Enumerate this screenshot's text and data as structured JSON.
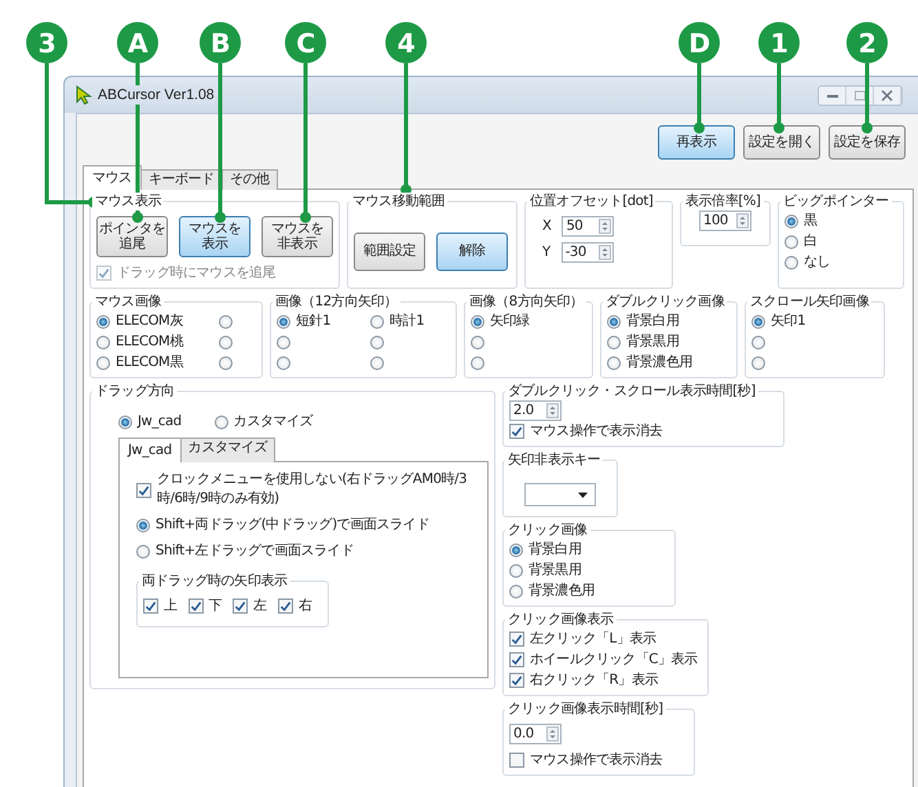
{
  "callouts": [
    {
      "label": "3"
    },
    {
      "label": "A"
    },
    {
      "label": "B"
    },
    {
      "label": "C"
    },
    {
      "label": "4"
    },
    {
      "label": "D"
    },
    {
      "label": "1"
    },
    {
      "label": "2"
    }
  ],
  "window": {
    "title": "ABCursor Ver1.08"
  },
  "toolbar": [
    {
      "label": "再表示",
      "highlighted": true
    },
    {
      "label": "設定を開く",
      "highlighted": false
    },
    {
      "label": "設定を保存",
      "highlighted": false
    }
  ],
  "tabs": [
    {
      "label": "マウス",
      "selected": true
    },
    {
      "label": "キーボード",
      "selected": false
    },
    {
      "label": "その他",
      "selected": false
    }
  ],
  "mouse_display": {
    "title": "マウス表示",
    "buttons": [
      {
        "lines": [
          "ポインタを",
          "追尾"
        ],
        "highlighted": false
      },
      {
        "lines": [
          "マウスを",
          "表示"
        ],
        "highlighted": true
      },
      {
        "lines": [
          "マウスを",
          "非表示"
        ],
        "highlighted": false
      }
    ],
    "checkbox": {
      "label": "ドラッグ時にマウスを追尾",
      "checked": true,
      "disabled": true
    }
  },
  "mouse_range": {
    "title": "マウス移動範囲",
    "buttons": [
      {
        "label": "範囲設定",
        "highlighted": false
      },
      {
        "label": "解除",
        "highlighted": true
      }
    ]
  },
  "offset": {
    "title": "位置オフセット[dot]",
    "fields": [
      {
        "label": "X",
        "value": "50"
      },
      {
        "label": "Y",
        "value": "-30"
      }
    ]
  },
  "scale": {
    "title": "表示倍率[%]",
    "value": "100"
  },
  "big_pointer": {
    "title": "ビッグポインター",
    "options": [
      {
        "label": "黒",
        "selected": true
      },
      {
        "label": "白",
        "selected": false
      },
      {
        "label": "なし",
        "selected": false
      }
    ]
  },
  "image_groups": [
    {
      "title": "マウス画像",
      "options": [
        {
          "label": "ELECOM灰",
          "selected": true
        },
        {
          "selected": false
        },
        {
          "label": "ELECOM桃",
          "selected": false
        },
        {
          "selected": false
        },
        {
          "label": "ELECOM黒",
          "selected": false
        },
        {
          "selected": false
        }
      ]
    },
    {
      "title": "画像（12方向矢印）",
      "options": [
        {
          "label": "短針1",
          "selected": true
        },
        {
          "label": "時計1",
          "selected": false
        },
        {
          "selected": false
        },
        {
          "selected": false
        },
        {
          "selected": false
        },
        {
          "selected": false
        }
      ]
    },
    {
      "title": "画像（8方向矢印）",
      "options": [
        {
          "label": "矢印緑",
          "selected": true
        },
        {
          "selected": false
        },
        {
          "selected": false
        }
      ]
    },
    {
      "title": "ダブルクリック画像",
      "options": [
        {
          "label": "背景白用",
          "selected": true
        },
        {
          "label": "背景黒用",
          "selected": false
        },
        {
          "label": "背景濃色用",
          "selected": false
        }
      ]
    },
    {
      "title": "スクロール矢印画像",
      "options": [
        {
          "label": "矢印1",
          "selected": true
        },
        {
          "selected": false
        },
        {
          "selected": false
        }
      ]
    }
  ],
  "drag_direction": {
    "title": "ドラッグ方向",
    "modes": [
      {
        "label": "Jw_cad",
        "selected": true
      },
      {
        "label": "カスタマイズ",
        "selected": false
      }
    ],
    "tabs": [
      {
        "label": "Jw_cad",
        "selected": true
      },
      {
        "label": "カスタマイズ",
        "selected": false
      }
    ],
    "options": [
      {
        "kind": "checkbox",
        "label": "クロックメニューを使用しない(右ドラッグAM0時/3時/6時/9時のみ有効)",
        "checked": true
      },
      {
        "kind": "radio",
        "label": "Shift+両ドラッグ(中ドラッグ)で画面スライド",
        "selected": true
      },
      {
        "kind": "radio",
        "label": "Shift+左ドラッグで画面スライド",
        "selected": false
      }
    ],
    "arrow_display": {
      "title": "両ドラッグ時の矢印表示",
      "items": [
        {
          "label": "上",
          "checked": true
        },
        {
          "label": "下",
          "checked": true
        },
        {
          "label": "左",
          "checked": true
        },
        {
          "label": "右",
          "checked": true
        }
      ]
    }
  },
  "display_time": {
    "title": "ダブルクリック・スクロール表示時間[秒]",
    "value": "2.0",
    "checkbox": {
      "label": "マウス操作で表示消去",
      "checked": true
    }
  },
  "hide_key": {
    "title": "矢印非表示キー"
  },
  "click_image": {
    "title": "クリック画像",
    "options": [
      {
        "label": "背景白用",
        "selected": true
      },
      {
        "label": "背景黒用",
        "selected": false
      },
      {
        "label": "背景濃色用",
        "selected": false
      }
    ]
  },
  "click_display": {
    "title": "クリック画像表示",
    "items": [
      {
        "label": "左クリック「L」表示",
        "checked": true
      },
      {
        "label": "ホイールクリック「C」表示",
        "checked": true
      },
      {
        "label": "右クリック「R」表示",
        "checked": true
      }
    ]
  },
  "click_time": {
    "title": "クリック画像表示時間[秒]",
    "value": "0.0",
    "checkbox": {
      "label": "マウス操作で表示消去",
      "checked": false
    }
  }
}
